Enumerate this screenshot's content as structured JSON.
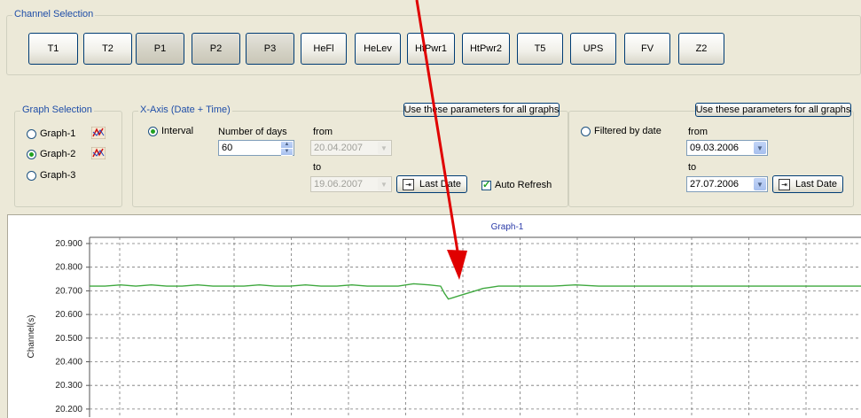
{
  "channel_selection": {
    "title": "Channel Selection",
    "buttons": [
      {
        "label": "T1",
        "selected": false
      },
      {
        "label": "T2",
        "selected": false
      },
      {
        "label": "P1",
        "selected": true
      },
      {
        "label": "P2",
        "selected": true
      },
      {
        "label": "P3",
        "selected": true
      },
      {
        "label": "HeFl",
        "selected": false
      },
      {
        "label": "HeLev",
        "selected": false
      },
      {
        "label": "HtPwr1",
        "selected": false
      },
      {
        "label": "HtPwr2",
        "selected": false
      },
      {
        "label": "T5",
        "selected": false
      },
      {
        "label": "UPS",
        "selected": false
      },
      {
        "label": "FV",
        "selected": false
      },
      {
        "label": "Z2",
        "selected": false
      }
    ]
  },
  "graph_selection": {
    "title": "Graph Selection",
    "options": [
      {
        "label": "Graph-1",
        "checked": false,
        "icon": "graph-chart-icon"
      },
      {
        "label": "Graph-2",
        "checked": true,
        "icon": "graph-chart-icon"
      },
      {
        "label": "Graph-3",
        "checked": false
      }
    ]
  },
  "x_axis": {
    "title": "X-Axis (Date + Time)",
    "use_params_label": "Use these parameters for all graphs",
    "interval_label": "Interval",
    "interval_checked": true,
    "number_of_days_label": "Number of days",
    "number_of_days_value": "60",
    "from_label": "from",
    "from_value": "20.04.2007",
    "to_label": "to",
    "to_value": "19.06.2007",
    "last_date_label": "Last Date",
    "auto_refresh_label": "Auto Refresh",
    "auto_refresh_checked": true
  },
  "filtered": {
    "use_params_label": "Use these parameters for all graphs",
    "filtered_label": "Filtered by date",
    "filtered_checked": false,
    "from_label": "from",
    "from_value": "09.03.2006",
    "to_label": "to",
    "to_value": "27.07.2006",
    "last_date_label": "Last Date"
  },
  "graph": {
    "title": "Graph-1",
    "ylabel": "Channel(s)",
    "line_color": "#3fa83f",
    "annotation_color": "#e00000"
  },
  "chart_data": {
    "type": "line",
    "title": "Graph-1",
    "ylabel": "Channel(s)",
    "xlabel": "",
    "ylim": [
      20.2,
      20.9
    ],
    "yticks": [
      "20.900",
      "20.800",
      "20.700",
      "20.600",
      "20.500",
      "20.400",
      "20.300",
      "20.200"
    ],
    "grid": true,
    "series": [
      {
        "values": [
          [
            0,
            20.72
          ],
          [
            0.02,
            20.72
          ],
          [
            0.04,
            20.725
          ],
          [
            0.06,
            20.72
          ],
          [
            0.08,
            20.725
          ],
          [
            0.1,
            20.72
          ],
          [
            0.12,
            20.72
          ],
          [
            0.14,
            20.725
          ],
          [
            0.16,
            20.72
          ],
          [
            0.18,
            20.72
          ],
          [
            0.2,
            20.72
          ],
          [
            0.22,
            20.725
          ],
          [
            0.24,
            20.72
          ],
          [
            0.26,
            20.72
          ],
          [
            0.28,
            20.725
          ],
          [
            0.3,
            20.72
          ],
          [
            0.32,
            20.72
          ],
          [
            0.34,
            20.725
          ],
          [
            0.36,
            20.72
          ],
          [
            0.38,
            20.72
          ],
          [
            0.4,
            20.72
          ],
          [
            0.42,
            20.73
          ],
          [
            0.44,
            20.725
          ],
          [
            0.455,
            20.72
          ],
          [
            0.46,
            20.69
          ],
          [
            0.465,
            20.665
          ],
          [
            0.47,
            20.67
          ],
          [
            0.48,
            20.68
          ],
          [
            0.49,
            20.69
          ],
          [
            0.5,
            20.7
          ],
          [
            0.51,
            20.71
          ],
          [
            0.52,
            20.715
          ],
          [
            0.53,
            20.72
          ],
          [
            0.55,
            20.72
          ],
          [
            0.57,
            20.72
          ],
          [
            0.6,
            20.72
          ],
          [
            0.63,
            20.725
          ],
          [
            0.66,
            20.72
          ],
          [
            0.7,
            20.72
          ],
          [
            0.74,
            20.72
          ],
          [
            0.78,
            20.72
          ],
          [
            0.82,
            20.72
          ],
          [
            0.86,
            20.72
          ],
          [
            0.9,
            20.72
          ],
          [
            0.94,
            20.72
          ],
          [
            1.0,
            20.72
          ]
        ]
      }
    ]
  }
}
